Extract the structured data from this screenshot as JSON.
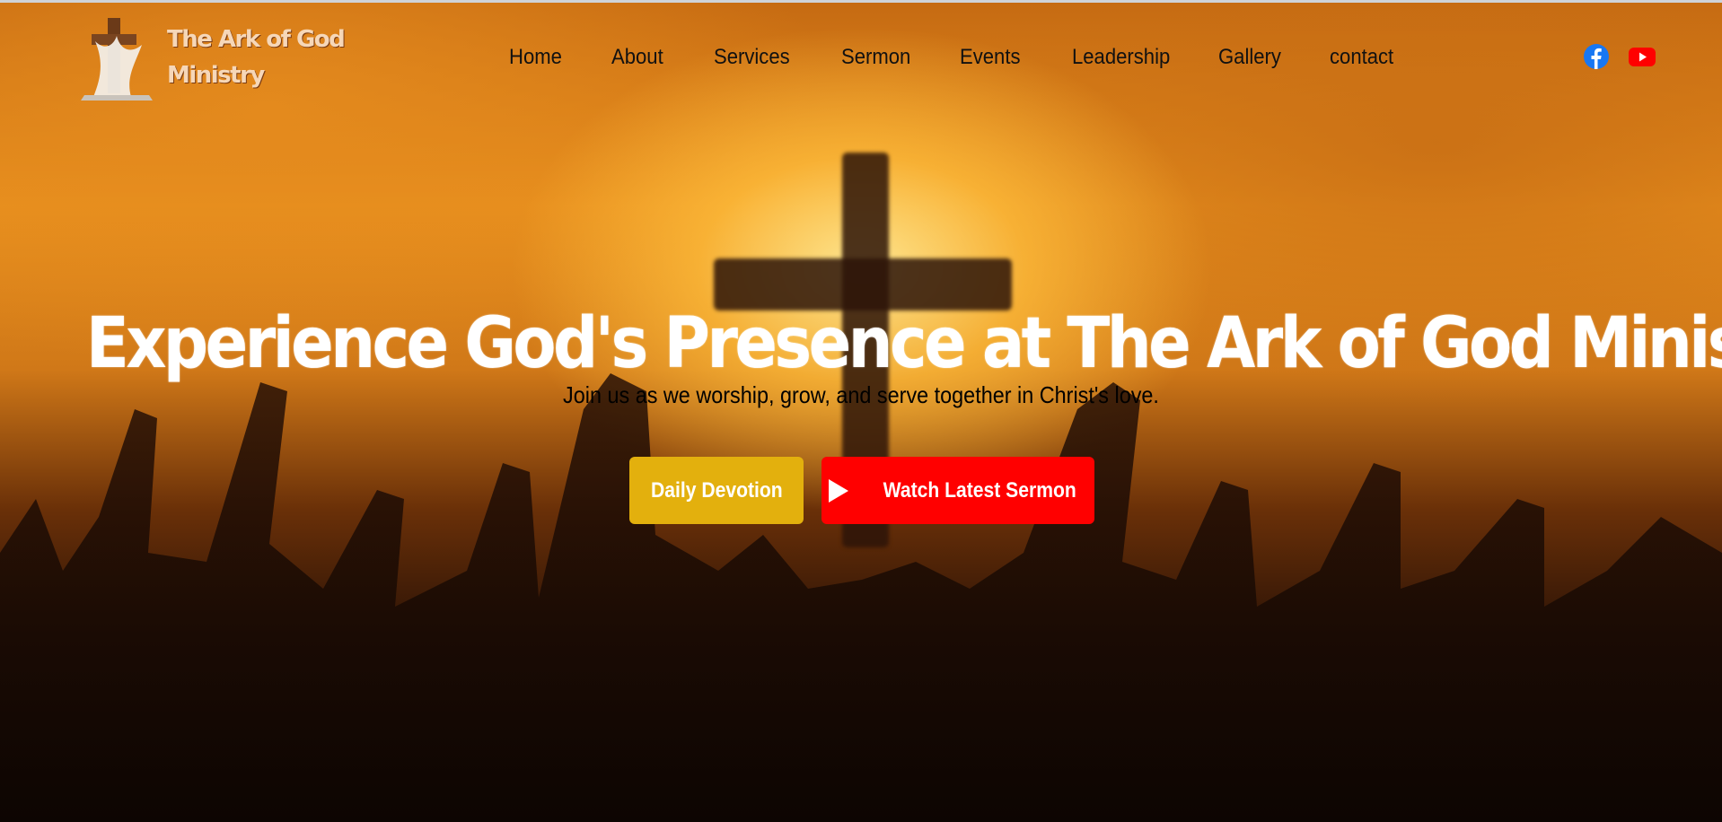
{
  "header": {
    "site_title": "The Ark of God Ministry",
    "logo_icon": "cross-with-cloth-logo",
    "nav": [
      {
        "label": "Home"
      },
      {
        "label": "About"
      },
      {
        "label": "Services"
      },
      {
        "label": "Sermon"
      },
      {
        "label": "Events"
      },
      {
        "label": "Leadership"
      },
      {
        "label": "Gallery"
      },
      {
        "label": "contact"
      }
    ],
    "social": [
      {
        "icon": "facebook-icon",
        "color": "#1877f2"
      },
      {
        "icon": "youtube-icon",
        "color": "#ff0000"
      }
    ]
  },
  "hero": {
    "headline": "Experience God's Presence at The Ark of God Ministry",
    "subline": "Join us as we worship, grow, and serve together in Christ's love.",
    "daily_devotion_label": "Daily Devotion",
    "watch_sermon_label": "Watch Latest Sermon",
    "play_icon": "play-icon",
    "colors": {
      "devotion_button": "#e3b00d",
      "sermon_button": "#ff0000"
    }
  }
}
